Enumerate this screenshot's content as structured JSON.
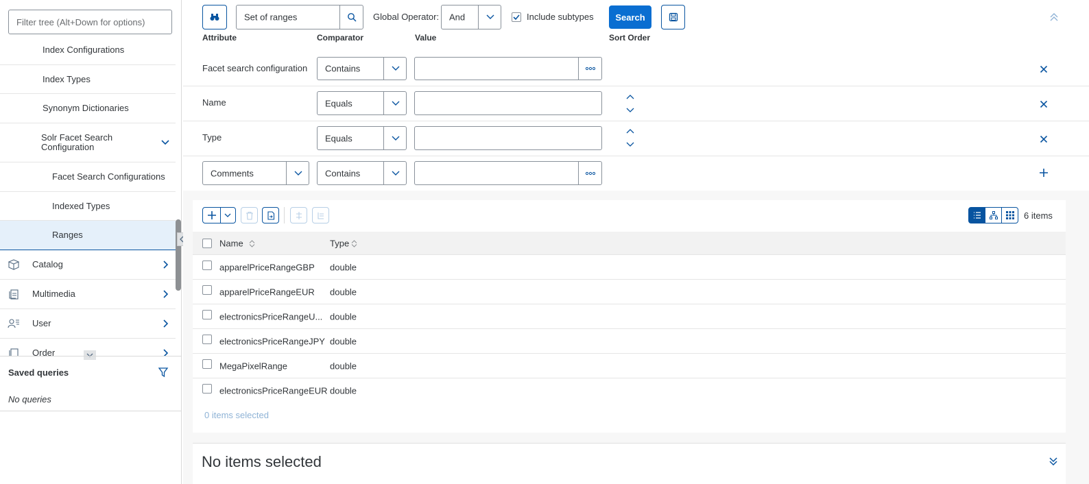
{
  "sidebar": {
    "filter_placeholder": "Filter tree (Alt+Down for options)",
    "tree": [
      {
        "label": "Index Configurations"
      },
      {
        "label": "Index Types"
      },
      {
        "label": "Synonym Dictionaries"
      },
      {
        "label": "Solr Facet Search Configuration"
      },
      {
        "label": "Facet Search Configurations"
      },
      {
        "label": "Indexed Types"
      },
      {
        "label": "Ranges"
      },
      {
        "label": "Catalog",
        "icon": "catalog-icon"
      },
      {
        "label": "Multimedia",
        "icon": "multimedia-icon"
      },
      {
        "label": "User",
        "icon": "user-icon"
      },
      {
        "label": "Order",
        "icon": "order-icon"
      }
    ],
    "saved_queries": {
      "title": "Saved queries",
      "empty": "No queries"
    }
  },
  "search": {
    "type_value": "Set of ranges",
    "global_operator_label": "Global Operator:",
    "global_operator_value": "And",
    "include_subtypes_label": "Include subtypes",
    "include_subtypes_checked": true,
    "search_label": "Search",
    "headers": {
      "attribute": "Attribute",
      "comparator": "Comparator",
      "value": "Value",
      "sort_order": "Sort Order"
    },
    "rows": [
      {
        "attribute": "Facet search configuration",
        "comparator": "Contains",
        "value": ""
      },
      {
        "attribute": "Name",
        "comparator": "Equals",
        "value": ""
      },
      {
        "attribute": "Type",
        "comparator": "Equals",
        "value": ""
      },
      {
        "attribute": "Comments",
        "comparator": "Contains",
        "value": ""
      }
    ]
  },
  "list": {
    "items_count": "6 items",
    "columns": {
      "name": "Name",
      "type": "Type"
    },
    "rows": [
      {
        "name": "apparelPriceRangeGBP",
        "type": "double"
      },
      {
        "name": "apparelPriceRangeEUR",
        "type": "double"
      },
      {
        "name": "electronicsPriceRangeU...",
        "type": "double"
      },
      {
        "name": "electronicsPriceRangeJPY",
        "type": "double"
      },
      {
        "name": "MegaPixelRange",
        "type": "double"
      },
      {
        "name": "electronicsPriceRangeEUR",
        "type": "double"
      }
    ],
    "selected_count": "0 items selected"
  },
  "details": {
    "title": "No items selected"
  },
  "colors": {
    "accent": "#0854a0",
    "primary": "#0a6ed1",
    "text": "#32363a",
    "selection": "#e5f0fa"
  }
}
